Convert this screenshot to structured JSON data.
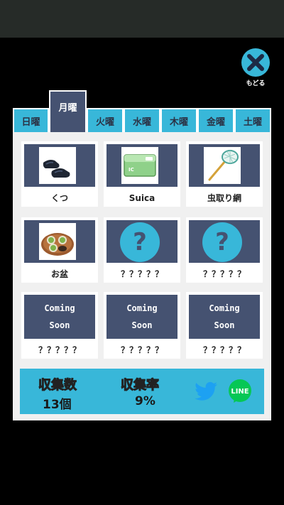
{
  "header": {
    "close_label": "もどる"
  },
  "tabs": [
    {
      "label": "日曜"
    },
    {
      "label": "月曜",
      "active": true
    },
    {
      "label": "火曜"
    },
    {
      "label": "水曜"
    },
    {
      "label": "木曜"
    },
    {
      "label": "金曜"
    },
    {
      "label": "土曜"
    }
  ],
  "items": [
    {
      "name": "くつ",
      "icon": "shoes-icon"
    },
    {
      "name": "Suica",
      "icon": "ic-card-icon"
    },
    {
      "name": "虫取り網",
      "icon": "bug-net-icon"
    },
    {
      "name": "お盆",
      "icon": "tea-tray-icon"
    },
    {
      "name": "？？？？？",
      "icon": "question-icon"
    },
    {
      "name": "？？？？？",
      "icon": "question-icon"
    },
    {
      "name": "？？？？？",
      "icon": "coming-soon",
      "line1": "Coming",
      "line2": "Soon"
    },
    {
      "name": "？？？？？",
      "icon": "coming-soon",
      "line1": "Coming",
      "line2": "Soon"
    },
    {
      "name": "？？？？？",
      "icon": "coming-soon",
      "line1": "Coming",
      "line2": "Soon"
    }
  ],
  "card_text": {
    "suica_chip": "IC",
    "question_mark": "?"
  },
  "stats": {
    "count_label": "収集数",
    "count_value": "13個",
    "rate_label": "収集率",
    "rate_value": "9%",
    "line_label": "LINE"
  },
  "colors": {
    "accent": "#38b7d9",
    "navy": "#455271",
    "count_label": "#e53b3b",
    "rate_label": "#f0c419",
    "twitter": "#1da1f2",
    "line": "#06c755"
  }
}
